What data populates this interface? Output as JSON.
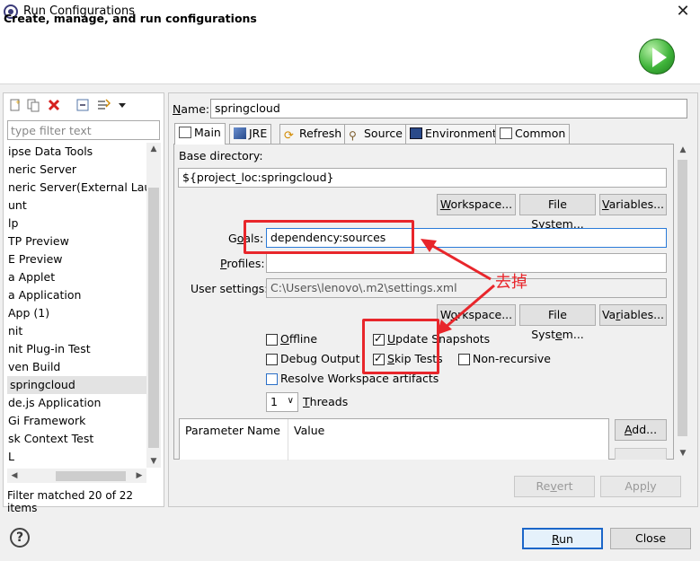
{
  "window": {
    "title": "Run Configurations",
    "header_title": "Create, manage, and run configurations",
    "icons": [
      "eclipse-icon",
      "close-icon",
      "run-icon"
    ]
  },
  "left": {
    "toolbar_icons": [
      "new-configuration-icon",
      "duplicate-icon",
      "delete-icon",
      "collapse-all-icon",
      "filter-icon",
      "dropdown-arrow-icon"
    ],
    "filter_placeholder": "type filter text",
    "tree_items": [
      "ipse Data Tools",
      "neric Server",
      "neric Server(External Launc",
      "unt",
      "lp",
      "TP Preview",
      "E Preview",
      "a Applet",
      "a Application",
      "App (1)",
      "nit",
      "nit Plug-in Test",
      "ven Build",
      "springcloud",
      "de.js Application",
      "Gi Framework",
      "sk Context Test",
      "L"
    ],
    "selected_index": 13,
    "status": "Filter matched 20 of 22 items"
  },
  "right": {
    "name_label": "Name:",
    "name_value": "springcloud",
    "tabs": [
      {
        "label": "Main",
        "icon": "main-tab-icon"
      },
      {
        "label": "JRE",
        "icon": "jre-tab-icon"
      },
      {
        "label": "Refresh",
        "icon": "refresh-tab-icon"
      },
      {
        "label": "Source",
        "icon": "source-tab-icon"
      },
      {
        "label": "Environment",
        "icon": "environment-tab-icon"
      },
      {
        "label": "Common",
        "icon": "common-tab-icon"
      }
    ],
    "base_directory_label": "Base directory:",
    "base_directory_value": "${project_loc:springcloud}",
    "buttons_row1": [
      "Workspace...",
      "File System...",
      "Variables..."
    ],
    "goals_label": "Goals:",
    "goals_value": "dependency:sources",
    "profiles_label": "Profiles:",
    "profiles_value": "",
    "user_settings_label": "User settings:",
    "user_settings_value": "C:\\Users\\lenovo\\.m2\\settings.xml",
    "buttons_row2": [
      "Workspace...",
      "File System...",
      "Variables..."
    ],
    "checkboxes": {
      "offline": {
        "label": "Offline",
        "checked": false
      },
      "update_snapshots": {
        "label": "Update Snapshots",
        "checked": true
      },
      "debug_output": {
        "label": "Debug Output",
        "checked": false
      },
      "skip_tests": {
        "label": "Skip Tests",
        "checked": true
      },
      "non_recursive": {
        "label": "Non-recursive",
        "checked": false
      },
      "resolve_workspace": {
        "label": "Resolve Workspace artifacts",
        "checked": false
      }
    },
    "threads_value": "1",
    "threads_label": "Threads",
    "params_table": {
      "columns": [
        "Parameter Name",
        "Value"
      ]
    },
    "add_button": "Add...",
    "revert_button": "Revert",
    "apply_button": "Apply"
  },
  "bottom": {
    "help_icon": "help-icon",
    "run_button": "Run",
    "close_button": "Close"
  },
  "annotation": {
    "text": "去掉",
    "color": "#e8262b"
  }
}
